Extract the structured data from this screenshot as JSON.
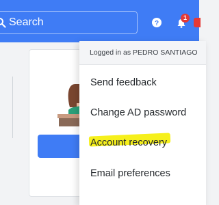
{
  "search": {
    "placeholder": "Search"
  },
  "notifications": {
    "count": "1"
  },
  "user_menu": {
    "logged_in_text": "Logged in as PEDRO SANTIAGO",
    "items": [
      {
        "label": "Send feedback"
      },
      {
        "label": "Change AD password"
      },
      {
        "label": "Account recovery",
        "highlighted": true
      },
      {
        "label": "Email preferences"
      }
    ]
  },
  "colors": {
    "topbar": "#3f7cf5",
    "highlight": "#f6f01c",
    "badge": "#e53935"
  },
  "icons": [
    "search-icon",
    "help-icon",
    "bell-icon"
  ]
}
